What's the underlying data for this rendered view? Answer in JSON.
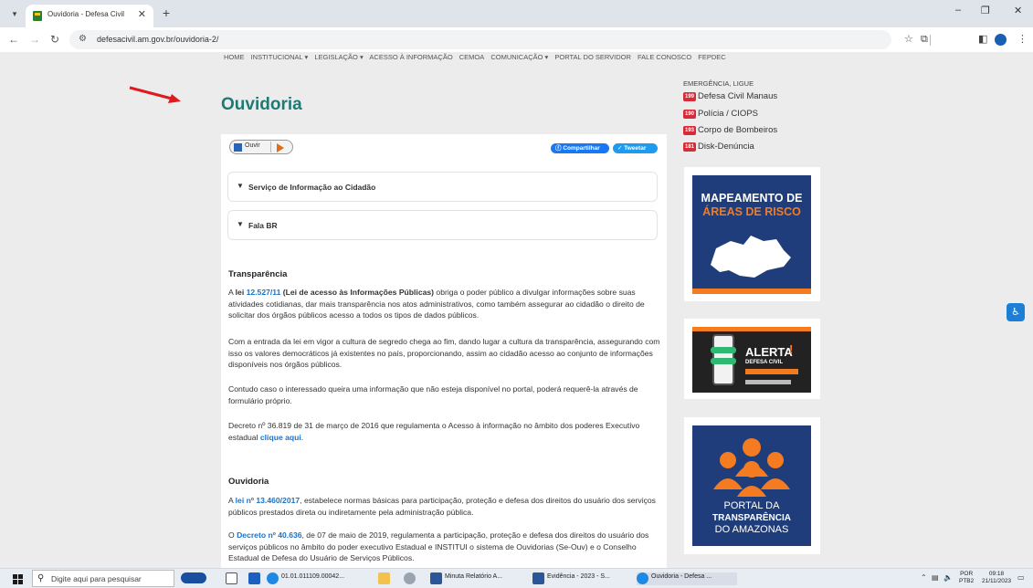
{
  "browser": {
    "tab_title": "Ouvidoria - Defesa Civil",
    "tab_close": "✕",
    "new_tab": "+",
    "url": "defesacivil.am.gov.br/ouvidoria-2/",
    "win_min": "–",
    "win_max": "❐",
    "win_close": "✕"
  },
  "nav": {
    "items": [
      "HOME",
      "INSTITUCIONAL ▾",
      "LEGISLAÇÃO ▾",
      "ACESSO À INFORMAÇÃO",
      "CEMOA",
      "COMUNICAÇÃO ▾",
      "PORTAL DO SERVIDOR",
      "FALE CONOSCO",
      "FEPDEC"
    ]
  },
  "page": {
    "title": "Ouvidoria",
    "ouvir_label": "Ouvir",
    "share_facebook": "Compartilhar",
    "share_twitter": "Tweetar",
    "accordion": [
      {
        "label": "Serviço de Informação ao Cidadão"
      },
      {
        "label": "Fala BR"
      }
    ],
    "transparencia": {
      "heading": "Transparência",
      "p1_a": "A ",
      "p1_lei": "lei",
      "p1_num": "12.527/11",
      "p1_bold": " (Lei de acesso às Informações Públicas)",
      "p1_rest": " obriga o poder público a divulgar informações sobre suas atividades cotidianas, dar mais transparência nos atos administrativos, como também assegurar ao cidadão o direito de solicitar dos órgãos públicos acesso a todos os tipos de dados públicos.",
      "p2": "Com a entrada da lei em vigor a cultura de segredo chega ao fim, dando lugar a cultura da transparência, assegurando com isso os valores democráticos já existentes no país, proporcionando, assim ao cidadão acesso ao conjunto de informações disponíveis nos órgãos públicos.",
      "p3": "Contudo caso o interessado queira uma informação que não esteja disponível no portal, poderá requerê-la através de formulário próprio.",
      "p4_a": "Decreto nº 36.819 de 31 de março de 2016 que regulamenta o Acesso à informação no âmbito dos poderes Executivo estadual ",
      "p4_link": "clique aqui",
      "p4_end": "."
    },
    "ouvidoria": {
      "heading": "Ouvidoria",
      "p1_a": "A ",
      "p1_link": "lei nº 13.460/2017",
      "p1_rest": ", estabelece normas básicas para participação, proteção e defesa dos direitos do usuário dos serviços públicos prestados direta ou indiretamente pela administração pública.",
      "p2_a": "O ",
      "p2_link": "Decreto nº 40.636",
      "p2_rest": ", de 07 de maio de 2019, regulamenta a participação, proteção e defesa dos direitos do usuário dos serviços públicos no âmbito do poder executivo Estadual e INSTITUI o sistema de Ouvidorias (Se-Ouv) e o Conselho Estadual de Defesa do Usuário de Serviços Públicos."
    }
  },
  "sidebar": {
    "emergency_title": "EMERGÊNCIA, LIGUE",
    "contacts": [
      {
        "code": "199",
        "label": "Defesa Civil Manaus"
      },
      {
        "code": "190",
        "label": "Polícia / CIOPS"
      },
      {
        "code": "193",
        "label": "Corpo de Bombeiros"
      },
      {
        "code": "181",
        "label": "Disk-Denúncia"
      }
    ],
    "banner1": {
      "line1": "MAPEAMENTO DE",
      "line2": "ÁREAS DE RISCO"
    },
    "banner2": {
      "title": "ALERTA",
      "subtitle": "DEFESA CIVIL"
    },
    "banner3": {
      "line1": "PORTAL DA",
      "line2": "TRANSPARÊNCIA",
      "line3": "DO AMAZONAS"
    }
  },
  "taskbar": {
    "search_placeholder": "Digite aqui para pesquisar",
    "apps": [
      {
        "label": "01.01.011109.00042..."
      },
      {
        "label": "Minuta Relatório A..."
      },
      {
        "label": "Evidência - 2023 - S..."
      },
      {
        "label": "Ouvidoria - Defesa ..."
      }
    ],
    "lang_top": "POR",
    "lang_bottom": "PTB2",
    "time": "09:18",
    "date": "21/11/2023"
  },
  "colors": {
    "accent": "#1f7a73",
    "link": "#1a73c9",
    "badge": "#d62b38",
    "brand_blue": "#1e3d7a",
    "brand_orange": "#f47b20"
  }
}
